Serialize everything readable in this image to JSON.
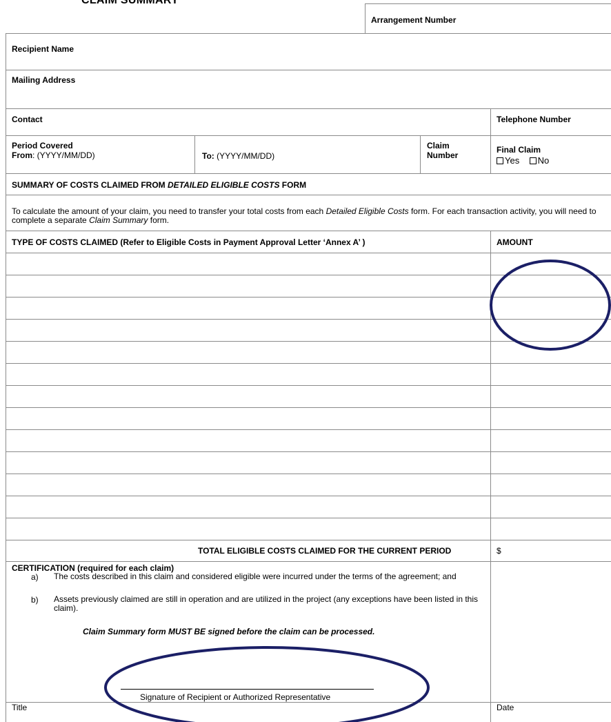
{
  "form": {
    "title": "CLAIM SUMMARY",
    "arrangement_number": "Arrangement Number",
    "recipient_name": "Recipient Name",
    "mailing_address": "Mailing Address",
    "contact": "Contact",
    "telephone_number": "Telephone Number",
    "period_covered": "Period Covered",
    "from_label": "From",
    "from_format": ":  (YYYY/MM/DD)",
    "to_label": "To:",
    "to_format": " (YYYY/MM/DD)",
    "claim_number_line1": "Claim",
    "claim_number_line2": "Number",
    "final_claim": "Final Claim",
    "yes": "Yes",
    "no": "No",
    "summary_heading_start": "SUMMARY OF COSTS CLAIMED FROM ",
    "summary_heading_italic": "DETAILED ELIGIBLE COSTS",
    "summary_heading_end": " FORM",
    "instructions_1": "To calculate the amount of your claim, you need to transfer your total costs from each ",
    "instructions_italic_1": "Detailed Eligible Costs",
    "instructions_2": " form.  For each transaction activity, you will need to complete a separate ",
    "instructions_italic_2": "Claim Summary",
    "instructions_3": " form.",
    "type_of_costs": "TYPE OF COSTS CLAIMED (Refer to Eligible Costs in Payment Approval Letter ‘Annex A’ )",
    "amount": "AMOUNT",
    "total_label": "TOTAL ELIGIBLE COSTS CLAIMED FOR THE CURRENT PERIOD",
    "currency": "$",
    "certification": "CERTIFICATION (required for each claim)",
    "cert_a_marker": "a)",
    "cert_a_text": "The costs described in this claim and considered eligible were incurred under the terms of the agreement; and",
    "cert_b_marker": "b)",
    "cert_b_text": "Assets previously claimed are still in operation and are utilized in the project (any exceptions have been listed in this claim).",
    "must_sign": "Claim Summary form MUST BE signed before the claim can be processed.",
    "signature_label": "Signature of Recipient or Authorized Representative",
    "title_label": "Title",
    "date_label": "Date"
  },
  "colors": {
    "annotation_ring": "#1b1f66",
    "rule_line": "#8a8a8a"
  }
}
